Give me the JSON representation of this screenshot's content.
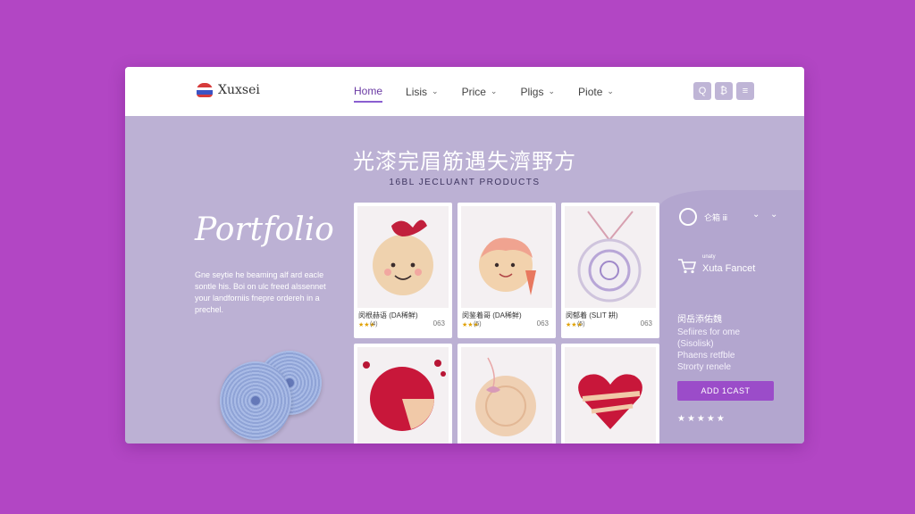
{
  "brand": {
    "name": "Xuxsei",
    "logo_icon": "flag-logo-icon"
  },
  "nav": {
    "items": [
      {
        "label": "Home",
        "active": true
      },
      {
        "label": "Lisis",
        "dropdown": true
      },
      {
        "label": "Price",
        "dropdown": true
      },
      {
        "label": "Pligs",
        "dropdown": true
      },
      {
        "label": "Piote",
        "dropdown": true
      }
    ],
    "actions": [
      {
        "icon": "search-icon",
        "glyph": "Q"
      },
      {
        "icon": "currency-icon",
        "glyph": "₿"
      },
      {
        "icon": "menu-icon",
        "glyph": "≡"
      }
    ]
  },
  "hero": {
    "title": "光漆完眉筋遇失濟野方",
    "subtitle": "16BL JECLUANT PRODUCTS"
  },
  "portfolio": {
    "title": "Portfolio",
    "description": "Gne seytie he beaming alf ard eacle sontle his. Boi on ulc freed alssennet your landforniis fnepre ordereh in a prechel."
  },
  "products": [
    {
      "label": "闵根赫语 (DA稀鲜)",
      "rating": "★★★",
      "reviews": "(4)",
      "price": "063",
      "art": "girl-bow"
    },
    {
      "label": "闵鉴着哥 (DA稀鲜)",
      "rating": "★★★",
      "reviews": "(5)",
      "price": "063",
      "art": "girl-hair"
    },
    {
      "label": "闵郁着 (SLIT 耕)",
      "rating": "★★★",
      "reviews": "(5)",
      "price": "063",
      "art": "pendant"
    },
    {
      "label": "",
      "art": "red-coaster"
    },
    {
      "label": "",
      "art": "peach-coaster"
    },
    {
      "label": "",
      "art": "heart"
    }
  ],
  "panel": {
    "top_text": "仑箱 ⅲ",
    "small_text": "unaty",
    "brand": "Xuta Fancet",
    "heading": "闵岳添佑魏",
    "lines": [
      "Sefiires for ome",
      "(Sisolisk)",
      "Phaens retfble",
      "Strorty renele"
    ],
    "add_to_cart": "ADD 1CAST",
    "stars": "★★★★★"
  },
  "colors": {
    "background": "#b246c4",
    "accent": "#9b4cc9",
    "panel": "#b3a6cf"
  }
}
